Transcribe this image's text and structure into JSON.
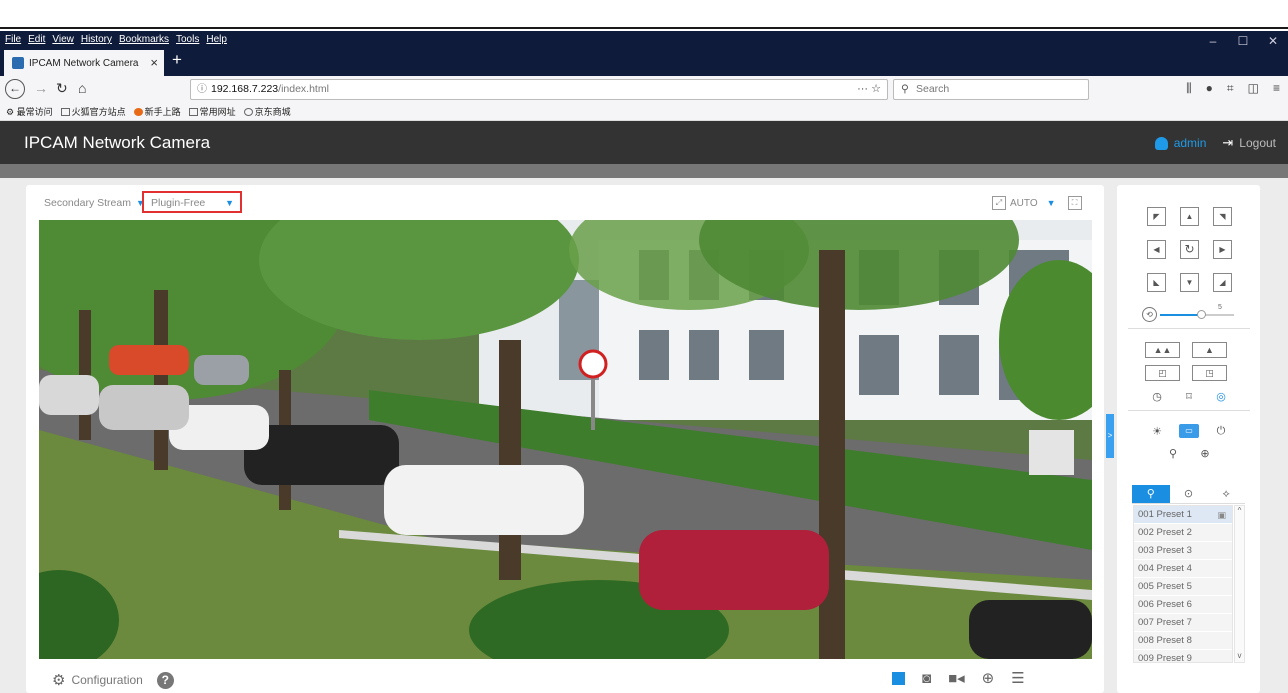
{
  "browser": {
    "menu": [
      "File",
      "Edit",
      "View",
      "History",
      "Bookmarks",
      "Tools",
      "Help"
    ],
    "tab_title": "IPCAM Network Camera",
    "url_host": "192.168.7.223",
    "url_path": "/index.html",
    "search_placeholder": "Search",
    "bookmarks": [
      "最常访问",
      "火狐官方站点",
      "新手上路",
      "常用网址",
      "京东商城"
    ]
  },
  "app": {
    "title": "IPCAM Network Camera",
    "user": "admin",
    "logout": "Logout",
    "stream": "Secondary Stream",
    "mode": "Plugin-Free",
    "view_mode": "AUTO",
    "configuration": "Configuration",
    "help": "?"
  },
  "ptz": {
    "zoom_value": "5",
    "zoom_level_fraction": 0.55
  },
  "presets": [
    "001 Preset 1",
    "002 Preset 2",
    "003 Preset 3",
    "004 Preset 4",
    "005 Preset 5",
    "006 Preset 6",
    "007 Preset 7",
    "008 Preset 8",
    "009 Preset 9"
  ],
  "colors": {
    "accent": "#1a8ee0",
    "header": "#333333",
    "highlight": "#e03030"
  }
}
